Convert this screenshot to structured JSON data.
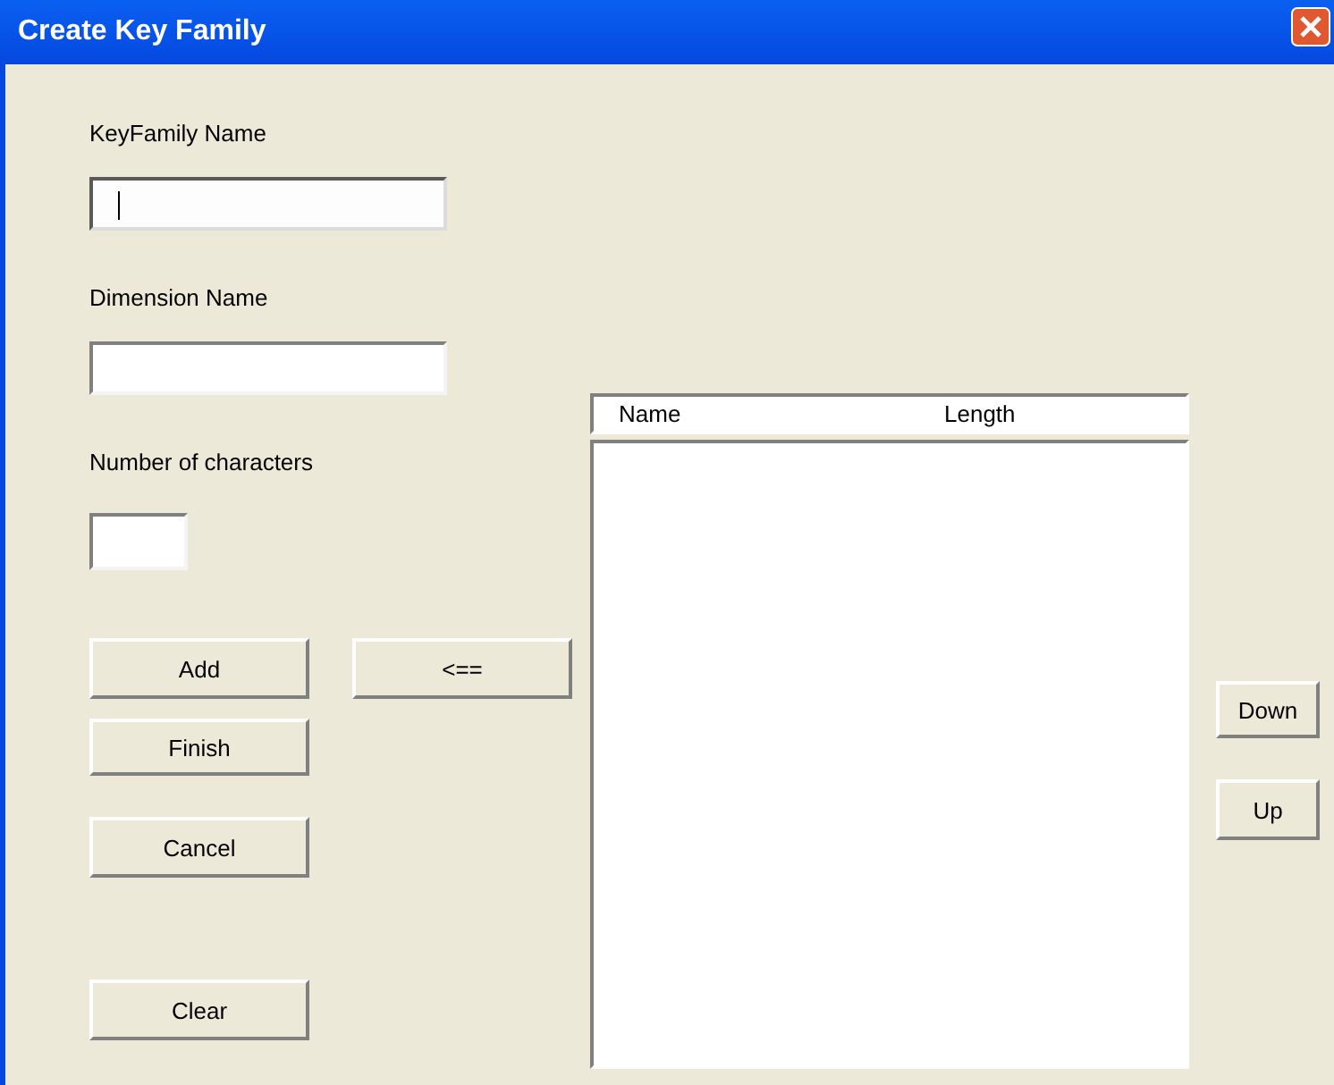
{
  "window": {
    "title": "Create Key Family"
  },
  "fields": [
    {
      "label": "KeyFamily Name",
      "kind": "text",
      "focused": true
    },
    {
      "label": "Dimension Name",
      "kind": "text",
      "focused": false
    },
    {
      "label": "Number of characters",
      "kind": "number",
      "focused": false
    }
  ],
  "actions": {
    "add": "Add",
    "move_left": "<==",
    "finish": "Finish",
    "cancel": "Cancel",
    "clear": "Clear"
  },
  "list": {
    "columns": [
      "Name",
      "Length"
    ]
  },
  "order_buttons": [
    "Down",
    "Up"
  ]
}
